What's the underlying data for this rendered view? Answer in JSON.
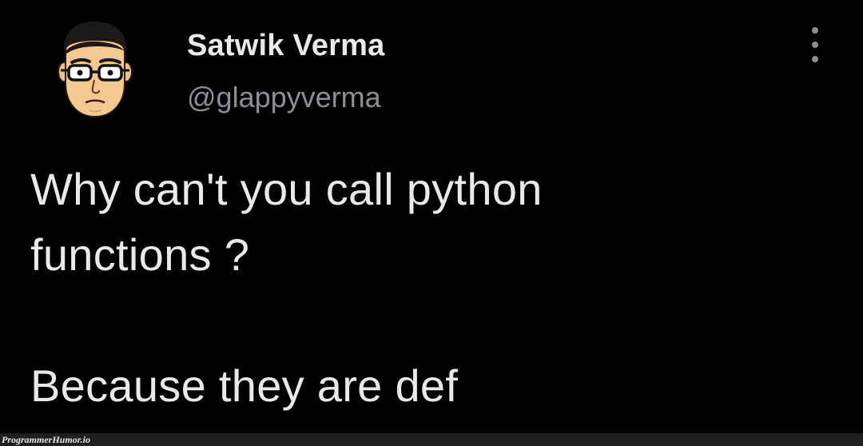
{
  "author": {
    "display_name": "Satwik Verma",
    "handle": "@glappyverma"
  },
  "more_menu": {
    "icon": "more-vertical-icon"
  },
  "tweet": {
    "line1": "Why can't you call python",
    "line2": "functions ?",
    "line3": "Because they are def"
  },
  "watermark": {
    "text": "ProgrammerHumor.io"
  },
  "colors": {
    "background": "#000000",
    "text_primary": "#e7e9ea",
    "text_secondary": "#8b9096",
    "watermark_bar": "#1f1f1f"
  }
}
